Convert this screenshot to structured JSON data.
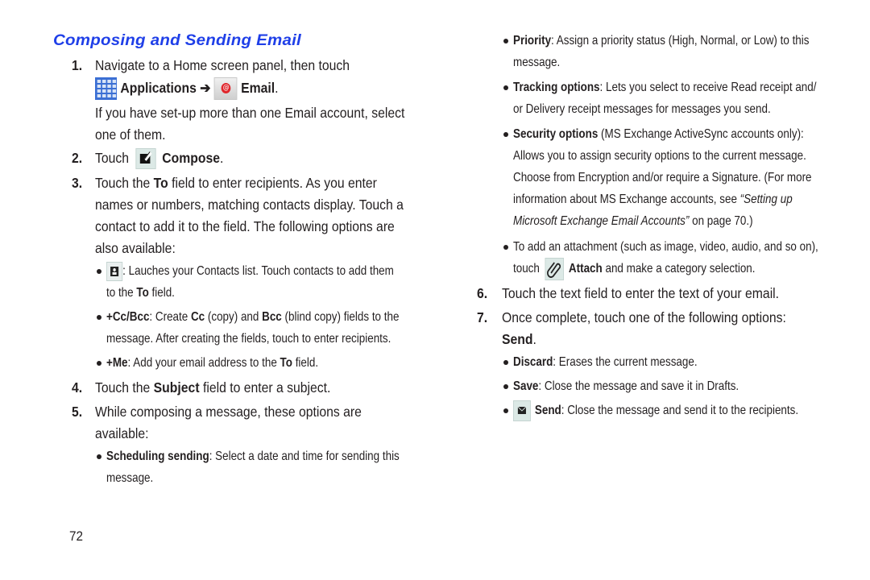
{
  "title": "Composing and Sending Email",
  "page_number": "72",
  "steps": {
    "s1": {
      "num": "1.",
      "line1": "Navigate to a Home screen panel, then touch",
      "applications": "Applications",
      "arrow": "➔",
      "email": "Email",
      "period": ".",
      "line3": "If you have set-up more than one Email account, select",
      "line4": "one of them."
    },
    "s2": {
      "num": "2.",
      "touch": "Touch",
      "compose": "Compose",
      "period": "."
    },
    "s3": {
      "num": "3.",
      "line1_a": "Touch the ",
      "line1_b": "To",
      "line1_c": " field to enter recipients. As you enter",
      "line2": "names or numbers, matching contacts display. Touch a",
      "line3": "contact to add it to the field. The following options are",
      "line4": "also available:",
      "bullets": [
        {
          "text_a": ": Lauches your Contacts list. Touch contacts to add them",
          "text_b": "to the ",
          "bold_b": "To",
          "text_c": " field."
        },
        {
          "bold": "+Cc/Bcc",
          "text_a": ": Create ",
          "bold_a": "Cc",
          "text_b": " (copy) and ",
          "bold_b": "Bcc",
          "text_c": " (blind copy) fields to the",
          "line2": "message. After creating the fields, touch to enter recipients."
        },
        {
          "bold": "+Me",
          "text_a": ": Add your email address to the ",
          "bold_a": "To",
          "text_b": " field."
        }
      ]
    },
    "s4": {
      "num": "4.",
      "text_a": "Touch the ",
      "bold": "Subject",
      "text_b": " field to enter a subject."
    },
    "s5": {
      "num": "5.",
      "line1": "While composing a message, these options are",
      "line2": "available:",
      "bullets": [
        {
          "bold": "Scheduling sending",
          "text": ": Select a date and time for sending this",
          "line2": "message."
        },
        {
          "bold": "Priority",
          "text": ": Assign a priority status (High, Normal, or Low) to this",
          "line2": "message."
        },
        {
          "bold": "Tracking options",
          "text": ": Lets you select to receive Read receipt and/",
          "line2": "or Delivery receipt messages for messages you send."
        },
        {
          "bold": "Security options",
          "text": " (MS Exchange ActiveSync accounts only):",
          "line2": "Allows you to assign security options to the current message.",
          "line3": "Choose from Encryption and/or require a Signature. (For more",
          "line4_a": "information about MS Exchange accounts, see ",
          "line4_i": "“Setting up",
          "line5_i": "Microsoft Exchange Email Accounts”",
          "line5_b": " on page 70.)"
        },
        {
          "text": "To add an attachment (such as image, video, audio, and so on),",
          "line2_a": "touch",
          "bold": "Attach",
          "line2_b": " and make a category selection."
        }
      ]
    },
    "s6": {
      "num": "6.",
      "text": "Touch the text field to enter the text of your email."
    },
    "s7": {
      "num": "7.",
      "line1": "Once complete, touch one of the following options:",
      "send": "Send",
      "period": ".",
      "bullets": [
        {
          "bold": "Discard",
          "text": ": Erases the current message."
        },
        {
          "bold": "Save",
          "text": ": Close the message and save it in Drafts."
        },
        {
          "bold": "Send",
          "text": ": Close the message and send it to the recipients."
        }
      ]
    }
  },
  "colors": {
    "title": "#1f3fe8",
    "text": "#231f20",
    "icon_bg": "#dce9e6",
    "apps_icon": "#3b6fd4",
    "email_badge": "#e0262c"
  }
}
